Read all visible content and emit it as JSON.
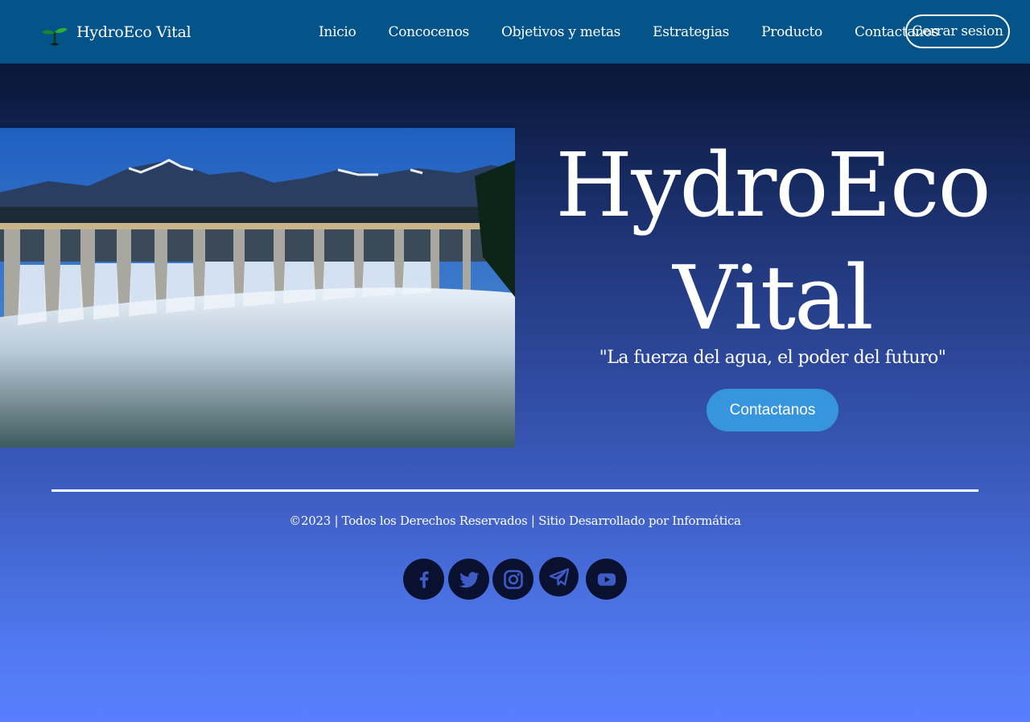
{
  "brand": {
    "name": "HydroEco Vital",
    "icon": "sprout-icon"
  },
  "nav": {
    "links": [
      "Inicio",
      "Concocenos",
      "Objetivos y metas",
      "Estrategias",
      "Producto",
      "Contactanos"
    ],
    "logout_label": "Cerrar sesion"
  },
  "hero": {
    "title_line1": "HydroEco",
    "title_line2": "Vital",
    "tagline": "\"La fuerza del agua, el poder del futuro\"",
    "cta_label": "Contactanos"
  },
  "footer": {
    "copyright": "©2023 | Todos los Derechos Reservados | Sitio Desarrollado por Informática",
    "social": [
      "facebook-icon",
      "twitter-icon",
      "instagram-icon",
      "telegram-icon",
      "youtube-icon"
    ]
  },
  "colors": {
    "navbar": "#04548a",
    "cta": "#3695dc",
    "social_bg": "#0a1030",
    "social_fg": "#3d5cc6"
  }
}
